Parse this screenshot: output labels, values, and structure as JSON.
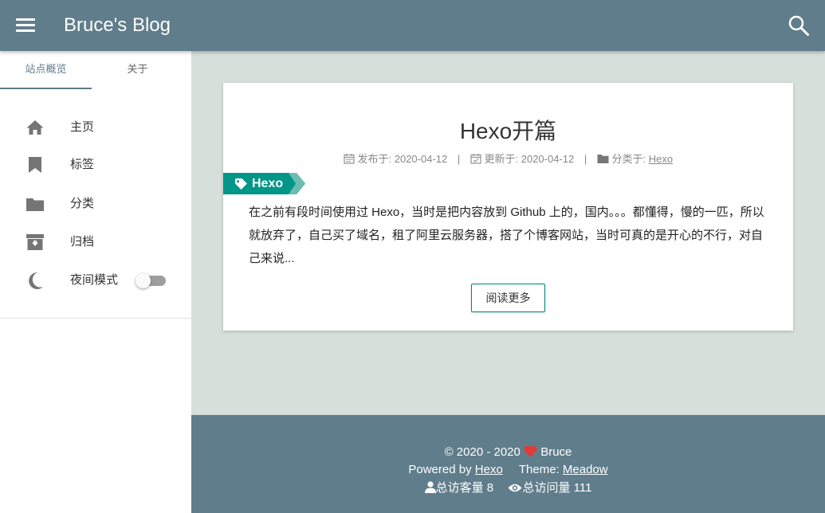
{
  "header": {
    "site_title": "Bruce's Blog",
    "menu_icon": "menu-icon",
    "search_icon": "search-icon"
  },
  "sidebar": {
    "tabs": [
      {
        "label": "站点概览",
        "active": true
      },
      {
        "label": "关于",
        "active": false
      }
    ],
    "nav": [
      {
        "label": "主页",
        "icon": "home-icon"
      },
      {
        "label": "标签",
        "icon": "bookmark-icon"
      },
      {
        "label": "分类",
        "icon": "folder-icon"
      },
      {
        "label": "归档",
        "icon": "archive-icon"
      },
      {
        "label": "夜间模式",
        "icon": "moon-icon",
        "toggle_on": false
      }
    ]
  },
  "post": {
    "title": "Hexo开篇",
    "meta": {
      "published_label": "发布于: 2020-04-12",
      "updated_label": "更新于: 2020-04-12",
      "category_prefix": "分类于: ",
      "category": "Hexo",
      "separator": "|"
    },
    "tag": "Hexo",
    "excerpt": "在之前有段时间使用过 Hexo，当时是把内容放到 Github 上的，国内。。。都懂得，慢的一匹，所以就放弃了，自己买了域名，租了阿里云服务器，搭了个博客网站，当时可真的是开心的不行，对自己来说...",
    "read_more": "阅读更多"
  },
  "footer": {
    "copyright": "© 2020 - 2020",
    "author": "Bruce",
    "powered_by": "Powered by ",
    "powered_link": "Hexo",
    "theme_label": "Theme: ",
    "theme_link": "Meadow",
    "visitors": "总访客量 8",
    "views": "总访问量 111"
  },
  "colors": {
    "primary": "#607d8b",
    "background": "#d6dfd9",
    "accent": "#00897b",
    "heart": "#e53935"
  }
}
